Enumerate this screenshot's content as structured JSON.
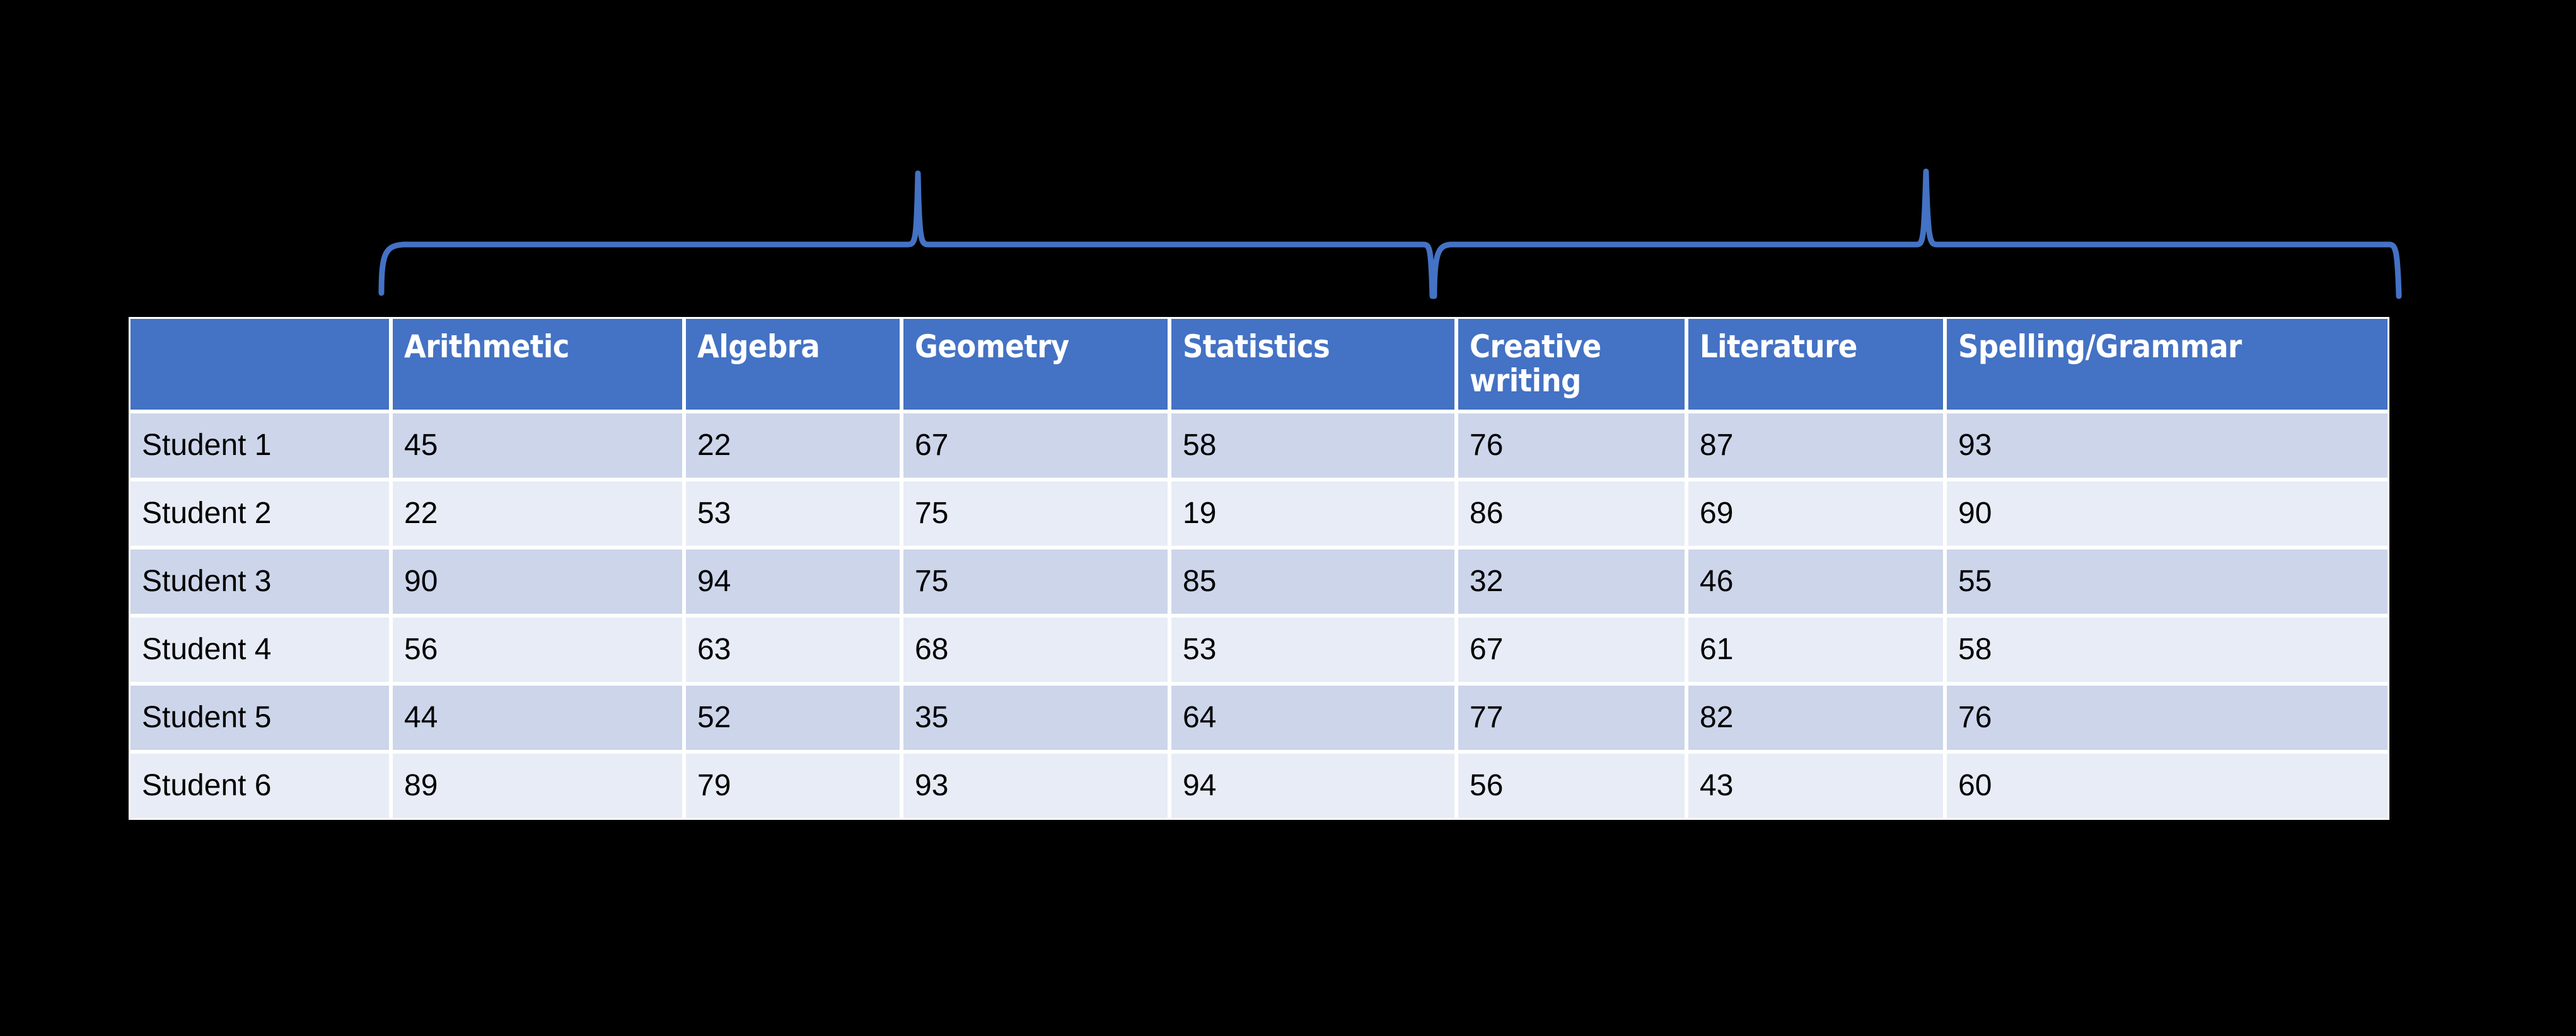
{
  "slide": {
    "background_color": "#000000",
    "accent_color": "#4472c4",
    "header_text_color": "#ffffff",
    "row_band_dark": "#ccd5ea",
    "row_band_light": "#e8ecf6",
    "cell_text_color": "#000000"
  },
  "braces": {
    "color": "#4472c4",
    "group_1": {
      "label": "",
      "spans_columns": [
        "Arithmetic",
        "Algebra",
        "Geometry",
        "Statistics"
      ]
    },
    "group_2": {
      "label": "",
      "spans_columns": [
        "Creative writing",
        "Literature",
        "Spelling/Grammar"
      ]
    }
  },
  "table": {
    "corner_header": "",
    "columns": [
      "Arithmetic",
      "Algebra",
      "Geometry",
      "Statistics",
      "Creative writing",
      "Literature",
      "Spelling/Grammar"
    ],
    "rows": [
      {
        "label": "Student 1",
        "values": [
          "45",
          "22",
          "67",
          "58",
          "76",
          "87",
          "93"
        ]
      },
      {
        "label": "Student 2",
        "values": [
          "22",
          "53",
          "75",
          "19",
          "86",
          "69",
          "90"
        ]
      },
      {
        "label": "Student 3",
        "values": [
          "90",
          "94",
          "75",
          "85",
          "32",
          "46",
          "55"
        ]
      },
      {
        "label": "Student 4",
        "values": [
          "56",
          "63",
          "68",
          "53",
          "67",
          "61",
          "58"
        ]
      },
      {
        "label": "Student 5",
        "values": [
          "44",
          "52",
          "35",
          "64",
          "77",
          "82",
          "76"
        ]
      },
      {
        "label": "Student 6",
        "values": [
          "89",
          "79",
          "93",
          "94",
          "56",
          "43",
          "60"
        ]
      }
    ]
  }
}
